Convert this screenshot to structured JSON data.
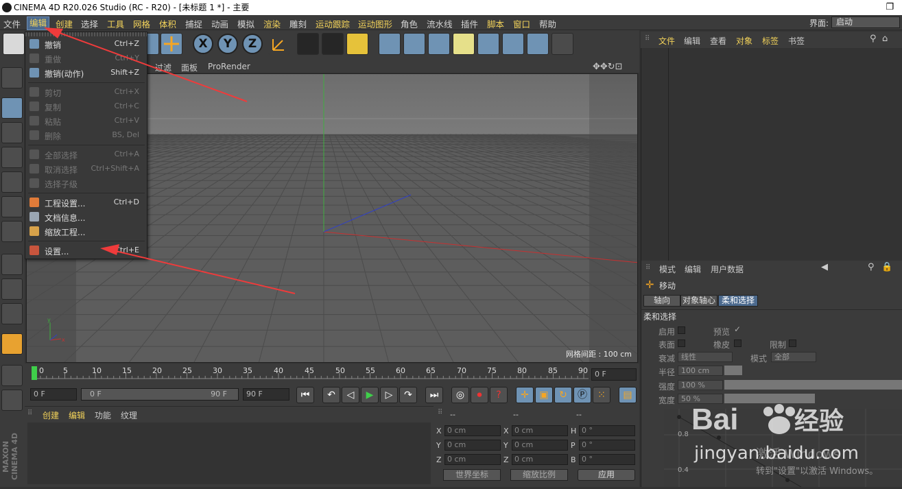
{
  "window": {
    "title": "CINEMA 4D R20.026 Studio (RC - R20) - [未标题 1 *] - 主要",
    "restore_glyph": "❐"
  },
  "menubar": {
    "items": [
      "文件",
      "编辑",
      "创建",
      "选择",
      "工具",
      "网格",
      "体积",
      "捕捉",
      "动画",
      "模拟",
      "渲染",
      "雕刻",
      "运动跟踪",
      "运动图形",
      "角色",
      "流水线",
      "插件",
      "脚本",
      "窗口",
      "帮助"
    ],
    "active_item": "编辑",
    "layout_label": "界面:",
    "layout_value": "启动"
  },
  "edit_menu": {
    "items": [
      {
        "label": "撤销",
        "shortcut": "Ctrl+Z",
        "enabled": true,
        "icon": "undo-icon"
      },
      {
        "label": "重做",
        "shortcut": "Ctrl+Y",
        "enabled": false,
        "icon": "redo-icon"
      },
      {
        "label": "撤销(动作)",
        "shortcut": "Shift+Z",
        "enabled": true,
        "icon": "undo-action-icon"
      },
      {
        "label": "剪切",
        "shortcut": "Ctrl+X",
        "enabled": false,
        "icon": "cut-icon"
      },
      {
        "label": "复制",
        "shortcut": "Ctrl+C",
        "enabled": false,
        "icon": "copy-icon"
      },
      {
        "label": "粘贴",
        "shortcut": "Ctrl+V",
        "enabled": false,
        "icon": "paste-icon"
      },
      {
        "label": "删除",
        "shortcut": "BS, Del",
        "enabled": false,
        "icon": "delete-icon"
      },
      {
        "label": "全部选择",
        "shortcut": "Ctrl+A",
        "enabled": false,
        "icon": "select-all-icon"
      },
      {
        "label": "取消选择",
        "shortcut": "Ctrl+Shift+A",
        "enabled": false,
        "icon": "deselect-icon"
      },
      {
        "label": "选择子级",
        "shortcut": "",
        "enabled": false,
        "icon": "select-children-icon"
      },
      {
        "label": "工程设置...",
        "shortcut": "Ctrl+D",
        "enabled": true,
        "icon": "project-settings-icon"
      },
      {
        "label": "文档信息...",
        "shortcut": "",
        "enabled": true,
        "icon": "document-info-icon"
      },
      {
        "label": "缩放工程...",
        "shortcut": "",
        "enabled": true,
        "icon": "scale-project-icon"
      },
      {
        "label": "设置...",
        "shortcut": "Ctrl+E",
        "enabled": true,
        "icon": "preferences-icon"
      }
    ]
  },
  "viewport": {
    "menu_items": [
      "过滤",
      "面板",
      "ProRender"
    ],
    "grid_spacing": "网格间距 : 100 cm"
  },
  "timeline": {
    "ticks": [
      "0",
      "5",
      "10",
      "15",
      "20",
      "25",
      "30",
      "35",
      "40",
      "45",
      "50",
      "55",
      "60",
      "65",
      "70",
      "75",
      "80",
      "85",
      "90"
    ],
    "current_frame": "0 F"
  },
  "transport": {
    "start_field": "0 F",
    "range_start": "0 F",
    "range_end": "90 F",
    "end_field": "90 F"
  },
  "material_panel": {
    "menu_items": [
      "创建",
      "编辑",
      "功能",
      "纹理"
    ]
  },
  "coord_panel": {
    "headers": [
      "--",
      "--",
      "--"
    ],
    "rows": [
      {
        "a": "X",
        "av": "0 cm",
        "b": "X",
        "bv": "0 cm",
        "c": "H",
        "cv": "0 °"
      },
      {
        "a": "Y",
        "av": "0 cm",
        "b": "Y",
        "bv": "0 cm",
        "c": "P",
        "cv": "0 °"
      },
      {
        "a": "Z",
        "av": "0 cm",
        "b": "Z",
        "bv": "0 cm",
        "c": "B",
        "cv": "0 °"
      }
    ],
    "world_coord": "世界坐标",
    "scale_ratio": "缩放比例",
    "apply": "应用"
  },
  "object_panel": {
    "menu_items": [
      "文件",
      "编辑",
      "查看",
      "对象",
      "标签",
      "书签"
    ]
  },
  "attribute_panel": {
    "menu_items": [
      "模式",
      "编辑",
      "用户数据"
    ],
    "tool_name": "移动",
    "tabs": [
      "轴向",
      "对象轴心",
      "柔和选择"
    ],
    "section": "柔和选择",
    "enable": "启用",
    "preview": "预览",
    "preview_check": "✓",
    "surface": "表面",
    "rubber": "橡皮",
    "restrict": "限制",
    "falloff": "衰减",
    "falloff_value": "线性",
    "mode": "模式",
    "mode_value": "全部",
    "radius": "半径",
    "radius_value": "100 cm",
    "strength": "强度",
    "strength_value": "100 %",
    "width": "宽度",
    "width_value": "50 %",
    "curve_labels": [
      "0.8",
      "0.4"
    ]
  },
  "watermark": {
    "site": "jingyan.baidu.com",
    "activate": "激活 Windows",
    "activate_hint": "转到\"设置\"以激活 Windows。"
  },
  "sidebar": {
    "brand": "MAXON CINEMA 4D"
  },
  "colors": {
    "accent": "#6f93b4",
    "menu_yellow": "#f2d25a",
    "arrow_red": "#ef3b3b"
  }
}
